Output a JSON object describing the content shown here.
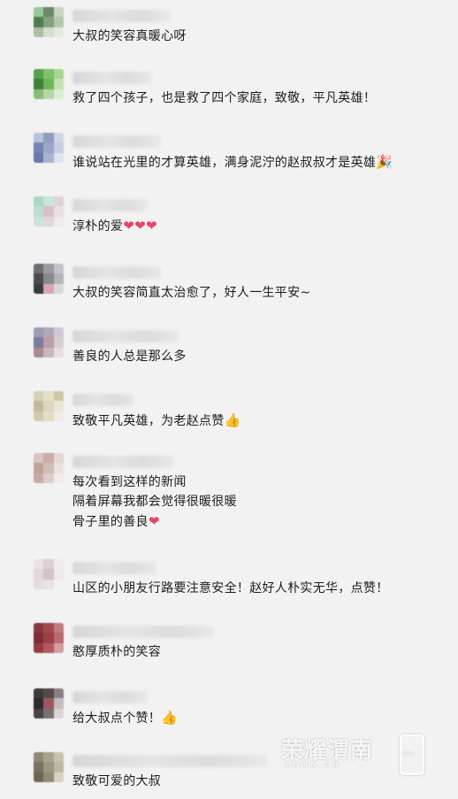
{
  "comments": [
    {
      "text": "大叔的笑容真暖心呀"
    },
    {
      "text": "救了四个孩子，也是救了四个家庭，致敬，平凡英雄！"
    },
    {
      "text": "谁说站在光里的才算英雄，满身泥泞的赵叔叔才是英雄",
      "emoji": "🎉"
    },
    {
      "text": "淳朴的爱",
      "emoji": "❤❤❤"
    },
    {
      "text": "大叔的笑容简直太治愈了，好人一生平安~"
    },
    {
      "text": "善良的人总是那么多"
    },
    {
      "text": "致敬平凡英雄，为老赵点赞",
      "emoji": "👍"
    },
    {
      "text": "每次看到这样的新闻\n隔着屏幕我都会觉得很暖很暖\n骨子里的善良",
      "emoji": "❤"
    },
    {
      "text": "山区的小朋友行路要注意安全！赵好人朴实无华，点赞！"
    },
    {
      "text": "憨厚质朴的笑容"
    },
    {
      "text": "给大叔点个赞！",
      "emoji": "👍"
    },
    {
      "text": "致敬可爱的大叔"
    }
  ],
  "watermark": {
    "main": "荣耀渭南",
    "sub": "YEWN.CN",
    "box": "APP"
  }
}
